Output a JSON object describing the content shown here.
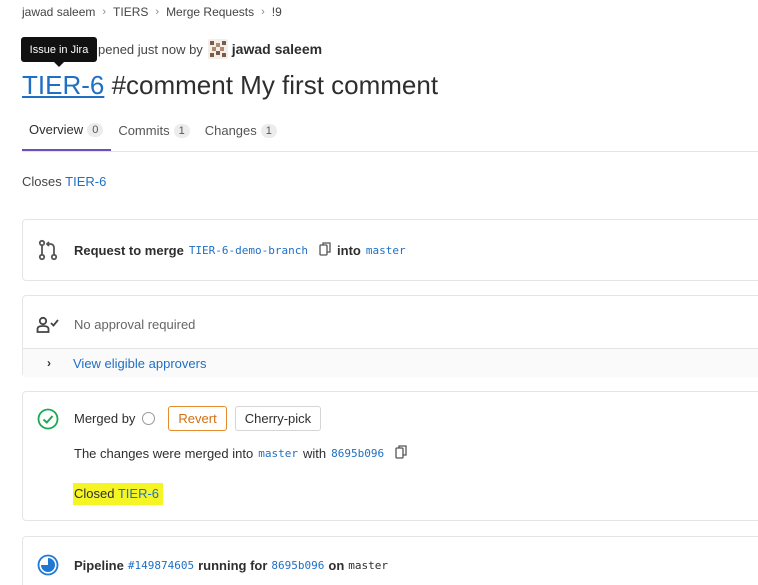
{
  "breadcrumb": {
    "items": [
      "jawad saleem",
      "TIERS",
      "Merge Requests",
      "!9"
    ],
    "separator": "›"
  },
  "tooltip": {
    "text": "Issue in Jira"
  },
  "header": {
    "opened_text": "pened just now by",
    "author": "jawad saleem",
    "title_link": "TIER-6",
    "title_rest": " #comment My first comment"
  },
  "tabs": [
    {
      "label": "Overview",
      "count": "0"
    },
    {
      "label": "Commits",
      "count": "1"
    },
    {
      "label": "Changes",
      "count": "1"
    }
  ],
  "closes": {
    "prefix": "Closes",
    "issue": "TIER-6"
  },
  "merge_request": {
    "prefix": "Request to merge",
    "source_branch": "TIER-6-demo-branch",
    "into": "into",
    "target_branch": "master"
  },
  "approval": {
    "status": "No approval required",
    "view_link": "View eligible approvers"
  },
  "merged": {
    "label": "Merged by",
    "revert_button": "Revert",
    "cherry_pick_button": "Cherry-pick",
    "changes_prefix": "The changes were merged into",
    "target_branch": "master",
    "with": "with",
    "commit": "8695b096",
    "closed_prefix": "Closed",
    "closed_issue": "TIER-6"
  },
  "pipeline": {
    "prefix": "Pipeline",
    "id": "#149874605",
    "status_text": "running for",
    "commit": "8695b096",
    "on": "on",
    "branch": "master"
  },
  "colors": {
    "link": "#1f6fc5",
    "success": "#1aaa55",
    "running": "#1f78d1",
    "highlight": "#f5f526",
    "warning": "#e48b2e"
  }
}
